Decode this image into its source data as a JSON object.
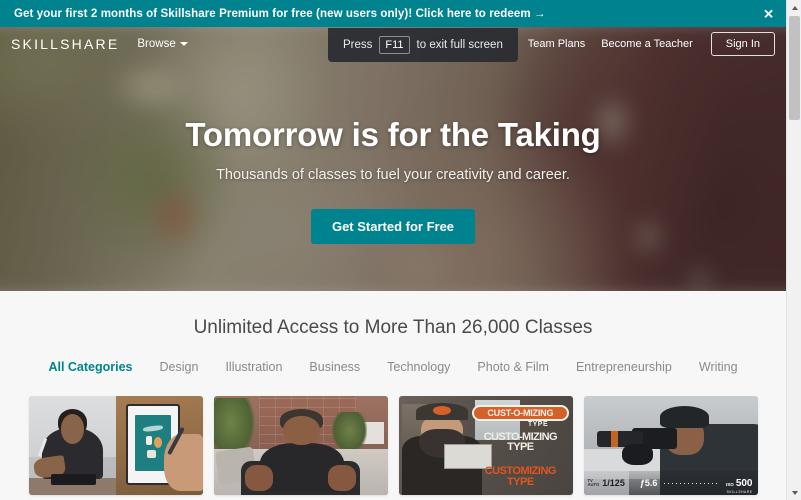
{
  "promo": {
    "text": "Get your first 2 months of Skillshare Premium for free (new users only)! Click here to redeem →",
    "close_label": "✕",
    "bg_color": "#00838f"
  },
  "nav": {
    "logo": "SKILLSHARE",
    "browse_label": "Browse",
    "links": [
      {
        "label": "Team Plans"
      },
      {
        "label": "Become a Teacher"
      }
    ],
    "signin_label": "Sign In"
  },
  "fullscreen_toast": {
    "prefix": "Press",
    "key": "F11",
    "suffix": "to exit full screen"
  },
  "hero": {
    "title": "Tomorrow is for the Taking",
    "subtitle": "Thousands of classes to fuel your creativity and career.",
    "cta_label": "Get Started for Free",
    "cta_color": "#00838f"
  },
  "classes": {
    "section_title": "Unlimited Access to More Than 26,000 Classes",
    "active_color": "#00838f",
    "tabs": [
      {
        "label": "All Categories",
        "active": true
      },
      {
        "label": "Design",
        "active": false
      },
      {
        "label": "Illustration",
        "active": false
      },
      {
        "label": "Business",
        "active": false
      },
      {
        "label": "Technology",
        "active": false
      },
      {
        "label": "Photo & Film",
        "active": false
      },
      {
        "label": "Entrepreneurship",
        "active": false
      },
      {
        "label": "Writing",
        "active": false
      }
    ],
    "cards": [
      {
        "name": "illustration-tablet-class"
      },
      {
        "name": "interview-sofa-class"
      },
      {
        "name": "customizing-type-class"
      },
      {
        "name": "photography-camera-class"
      }
    ]
  },
  "card3_overlay": {
    "line1": "CUST-O-MIZING",
    "line1b": "TYPE",
    "line2": "CUSTO-MIZING TYPE",
    "line3": "CUSTOMIZING TYPE"
  },
  "card4_overlay": {
    "mode_label_1": "TV",
    "mode_label_2": "AUTO",
    "shutter": "1/125",
    "aperture": "ƒ5.6",
    "iso_label": "ISO",
    "iso_value": "500",
    "brand": "SKILLSHARE"
  },
  "scrollbar": {
    "up_label": "▲",
    "down_label": "▼"
  }
}
